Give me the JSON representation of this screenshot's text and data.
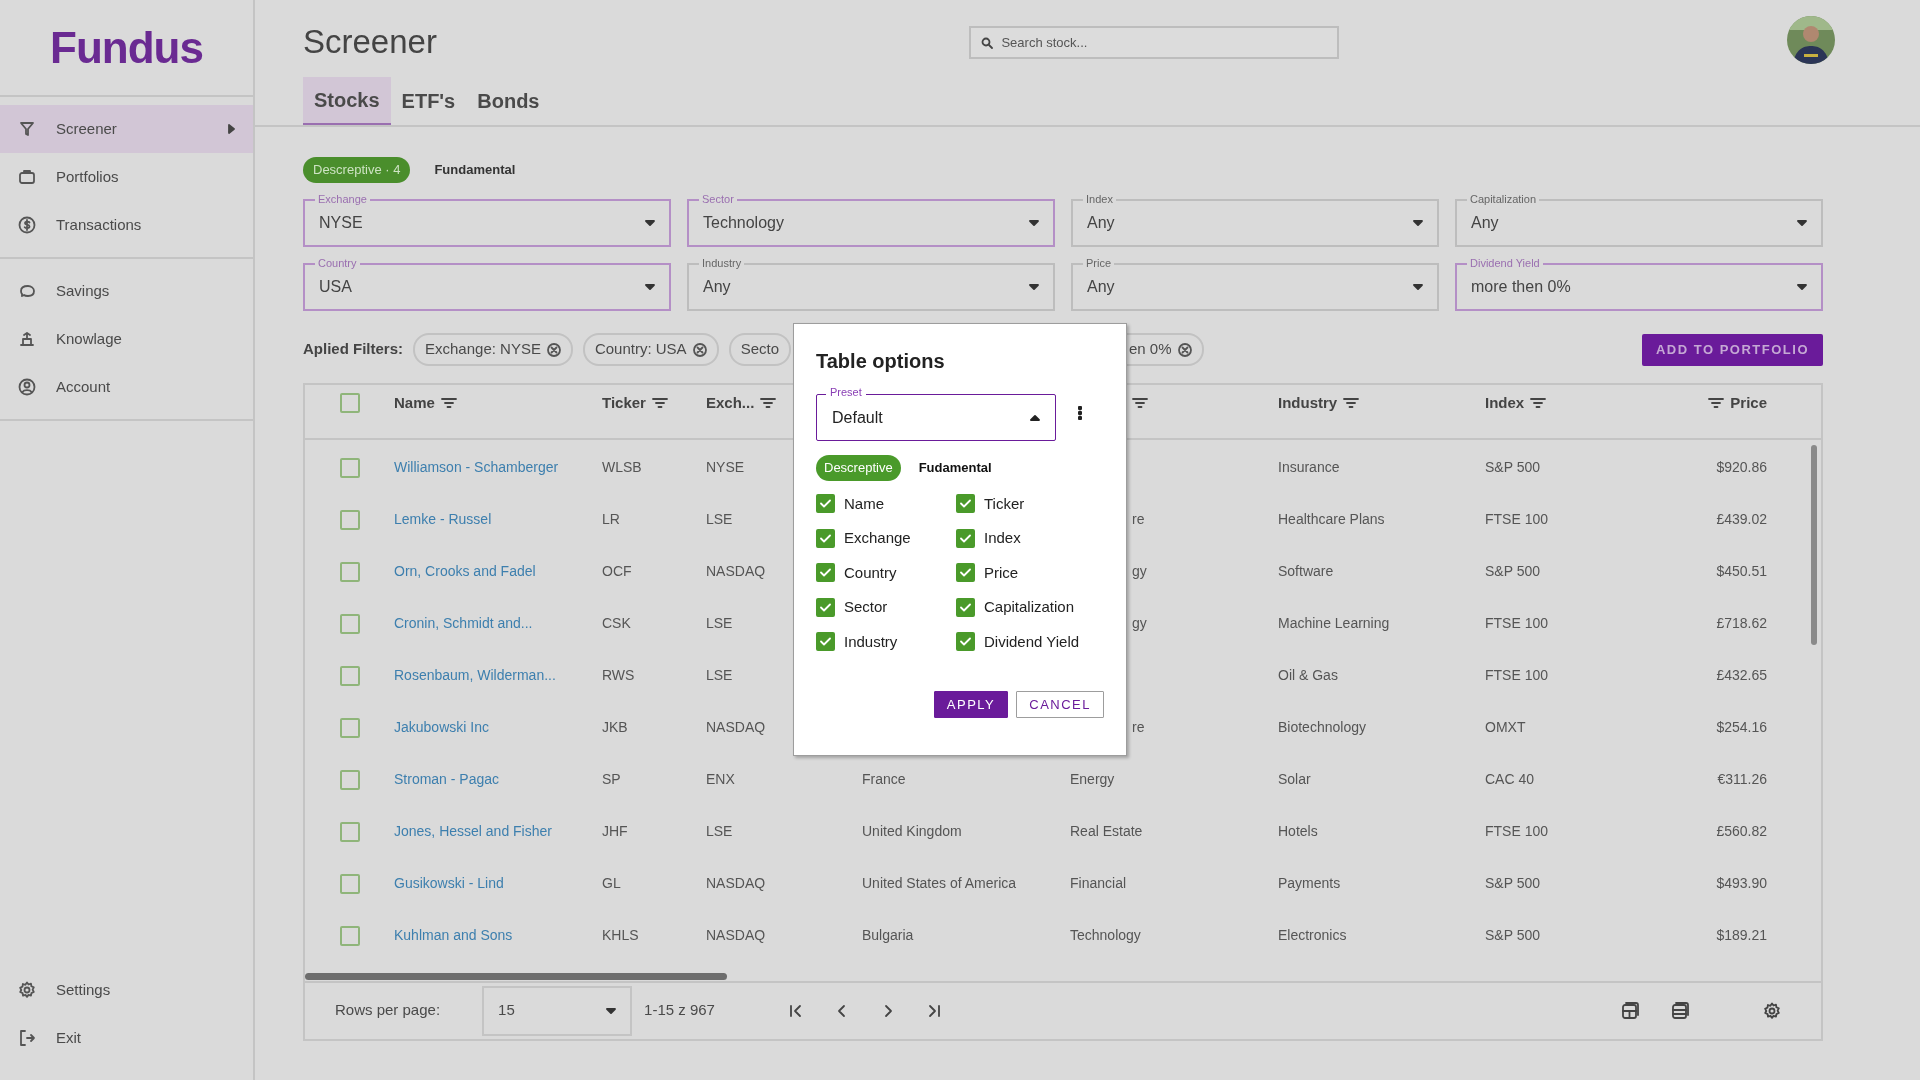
{
  "sidebar": {
    "logo": "Fundus",
    "groups": [
      [
        {
          "label": "Screener",
          "selected": true,
          "submenu": true
        },
        {
          "label": "Portfolios",
          "selected": false,
          "submenu": false
        },
        {
          "label": "Transactions",
          "selected": false,
          "submenu": false
        }
      ],
      [
        {
          "label": "Savings",
          "selected": false,
          "submenu": false
        },
        {
          "label": "Knowlage",
          "selected": false,
          "submenu": false
        },
        {
          "label": "Account",
          "selected": false,
          "submenu": false
        }
      ]
    ],
    "bottom": [
      {
        "label": "Settings"
      },
      {
        "label": "Exit"
      }
    ]
  },
  "header": {
    "title": "Screener",
    "search": {
      "placeholder": "Search stock..."
    }
  },
  "tabs": [
    {
      "label": "Stocks",
      "selected": true
    },
    {
      "label": "ETF's",
      "selected": false
    },
    {
      "label": "Bonds",
      "selected": false
    }
  ],
  "filter_groups": [
    {
      "label": "Descreptive · 4",
      "selected": true
    },
    {
      "label": "Fundamental",
      "selected": false
    }
  ],
  "filters": [
    {
      "label": "Exchange",
      "value": "NYSE",
      "active": true
    },
    {
      "label": "Sector",
      "value": "Technology",
      "active": true
    },
    {
      "label": "Index",
      "value": "Any",
      "active": false
    },
    {
      "label": "Capitalization",
      "value": "Any",
      "active": false
    },
    {
      "label": "Country",
      "value": "USA",
      "active": true
    },
    {
      "label": "Industry",
      "value": "Any",
      "active": false
    },
    {
      "label": "Price",
      "value": "Any",
      "active": false
    },
    {
      "label": "Dividend Yield",
      "value": "more then 0%",
      "active": true
    }
  ],
  "applied_filters": {
    "label": "Aplied Filters:",
    "chips": [
      {
        "text": "Exchange: NYSE",
        "kind": "full"
      },
      {
        "text": "Country: USA",
        "kind": "full"
      },
      {
        "text": "Secto",
        "kind": "cutright"
      },
      {
        "text": "en 0%",
        "kind": "cutleft"
      }
    ]
  },
  "add_button": "ADD TO PORTFOLIO",
  "table": {
    "columns": [
      {
        "label": "Name",
        "filter": true
      },
      {
        "label": "Ticker",
        "filter": true
      },
      {
        "label": "Exch...",
        "filter": true
      },
      {
        "filter": true
      },
      {
        "label": "Industry",
        "filter": true
      },
      {
        "label": "Index",
        "filter": true
      },
      {
        "label": "Price",
        "filter": true
      }
    ],
    "rows": [
      {
        "selected": false,
        "name": "Williamson - Schamberger",
        "ticker": "WLSB",
        "exchange": "NYSE",
        "industry": "Insurance",
        "index": "S&P 500",
        "price": "$920.86"
      },
      {
        "selected": false,
        "name": "Lemke - Russel",
        "ticker": "LR",
        "exchange": "LSE",
        "sector": "re",
        "sector_cut": true,
        "industry": "Healthcare Plans",
        "index": "FTSE 100",
        "price": "£439.02"
      },
      {
        "selected": false,
        "name": "Orn, Crooks and Fadel",
        "ticker": "OCF",
        "exchange": "NASDAQ",
        "sector": "gy",
        "sector_cut": true,
        "industry": "Software",
        "index": "S&P 500",
        "price": "$450.51"
      },
      {
        "selected": false,
        "name": "Cronin, Schmidt and...",
        "ticker": "CSK",
        "exchange": "LSE",
        "sector": "gy",
        "sector_cut": true,
        "industry": "Machine Learning",
        "index": "FTSE 100",
        "price": "£718.62"
      },
      {
        "selected": false,
        "name": "Rosenbaum, Wilderman...",
        "ticker": "RWS",
        "exchange": "LSE",
        "industry": "Oil & Gas",
        "index": "FTSE 100",
        "price": "£432.65"
      },
      {
        "selected": false,
        "name": "Jakubowski Inc",
        "ticker": "JKB",
        "exchange": "NASDAQ",
        "sector": "re",
        "sector_cut": true,
        "industry": "Biotechnology",
        "index": "OMXT",
        "price": "$254.16"
      },
      {
        "selected": false,
        "name": "Stroman - Pagac",
        "ticker": "SP",
        "exchange": "ENX",
        "country": "France",
        "sector": "Energy",
        "industry": "Solar",
        "index": "CAC 40",
        "price": "€311.26"
      },
      {
        "selected": false,
        "name": "Jones, Hessel and Fisher",
        "ticker": "JHF",
        "exchange": "LSE",
        "country": "United Kingdom",
        "sector": "Real Estate",
        "industry": "Hotels",
        "index": "FTSE 100",
        "price": "£560.82"
      },
      {
        "selected": false,
        "name": "Gusikowski - Lind",
        "ticker": "GL",
        "exchange": "NASDAQ",
        "country": "United States of America",
        "sector": "Financial",
        "industry": "Payments",
        "index": "S&P 500",
        "price": "$493.90"
      },
      {
        "selected": false,
        "name": "Kuhlman and Sons",
        "ticker": "KHLS",
        "exchange": "NASDAQ",
        "country": "Bulgaria",
        "sector": "Technology",
        "industry": "Electronics",
        "index": "S&P 500",
        "price": "$189.21"
      }
    ],
    "select_all": {
      "checked": false
    },
    "footer": {
      "rows_label": "Rows per page:",
      "rows_value": "15",
      "range": "1-15 z 967"
    }
  },
  "dialog": {
    "title": "Table options",
    "preset": {
      "label": "Preset",
      "value": "Default"
    },
    "tabs": [
      {
        "label": "Descreptive",
        "selected": true
      },
      {
        "label": "Fudamental",
        "selected": false
      }
    ],
    "options": [
      {
        "label": "Name",
        "checked": true
      },
      {
        "label": "Ticker",
        "checked": true
      },
      {
        "label": "Exchange",
        "checked": true
      },
      {
        "label": "Index",
        "checked": true
      },
      {
        "label": "Country",
        "checked": true
      },
      {
        "label": "Price",
        "checked": true
      },
      {
        "label": "Sector",
        "checked": true
      },
      {
        "label": "Capitalization",
        "checked": true
      },
      {
        "label": "Industry",
        "checked": true
      },
      {
        "label": "Dividend Yield",
        "checked": true
      }
    ],
    "buttons": [
      {
        "label": "APPLY",
        "kind": "primary"
      },
      {
        "label": "CANCEL",
        "kind": "outline"
      }
    ]
  }
}
